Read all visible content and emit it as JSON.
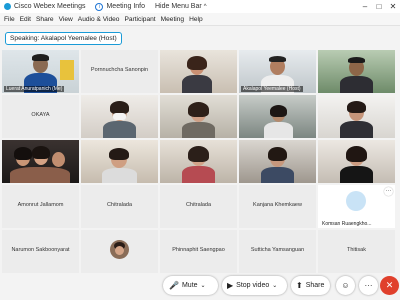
{
  "titlebar": {
    "app_title": "Cisco Webex Meetings",
    "meeting_info": "Meeting Info",
    "hide_menu": "Hide Menu Bar",
    "caret": "^",
    "minimize": "–",
    "maximize": "□",
    "close": "✕"
  },
  "menubar": [
    "File",
    "Edit",
    "Share",
    "View",
    "Audio & Video",
    "Participant",
    "Meeting",
    "Help"
  ],
  "speaking": "Speaking: Akalapol Yeemalee (Host)",
  "participants": [
    {
      "name": "Luerat Anuratpanich (Me)",
      "video": true
    },
    {
      "name": "Pornnuchcha Sanonpin",
      "video": false
    },
    {
      "name": "",
      "video": true
    },
    {
      "name": "Akalapol Yeemalee (Host)",
      "video": true
    },
    {
      "name": "",
      "video": true
    },
    {
      "name": "OKAYA",
      "video": false
    },
    {
      "name": "",
      "video": true
    },
    {
      "name": "",
      "video": true
    },
    {
      "name": "",
      "video": true
    },
    {
      "name": "",
      "video": true
    },
    {
      "name": "",
      "video": true
    },
    {
      "name": "",
      "video": true
    },
    {
      "name": "",
      "video": true
    },
    {
      "name": "",
      "video": true
    },
    {
      "name": "",
      "video": true
    },
    {
      "name": "Amonrut Jallamom",
      "video": false
    },
    {
      "name": "Chitralada",
      "video": false
    },
    {
      "name": "Chitralada",
      "video": false
    },
    {
      "name": "Kanjana Khemkaew",
      "video": false
    },
    {
      "name": "Komsan Ruaengkho...",
      "video": false
    },
    {
      "name": "Narumon Sakboonyarat",
      "video": false
    },
    {
      "name": "",
      "video": true
    },
    {
      "name": "Phinnaphit Saengpao",
      "video": false
    },
    {
      "name": "Sutticha Yamsanguan",
      "video": false
    },
    {
      "name": "Thitisak",
      "video": false
    }
  ],
  "more_glyph": "···",
  "bottombar": {
    "mute": "Mute",
    "stop_video": "Stop video",
    "share": "Share",
    "mute_icon": "🎤",
    "video_icon": "▶",
    "share_icon": "⬆",
    "reactions_icon": "☺",
    "more_icon": "···",
    "end_icon": "✕",
    "caret": "⌄"
  },
  "colors": {
    "accent": "#1a9bd7",
    "end_call": "#e0402c"
  }
}
